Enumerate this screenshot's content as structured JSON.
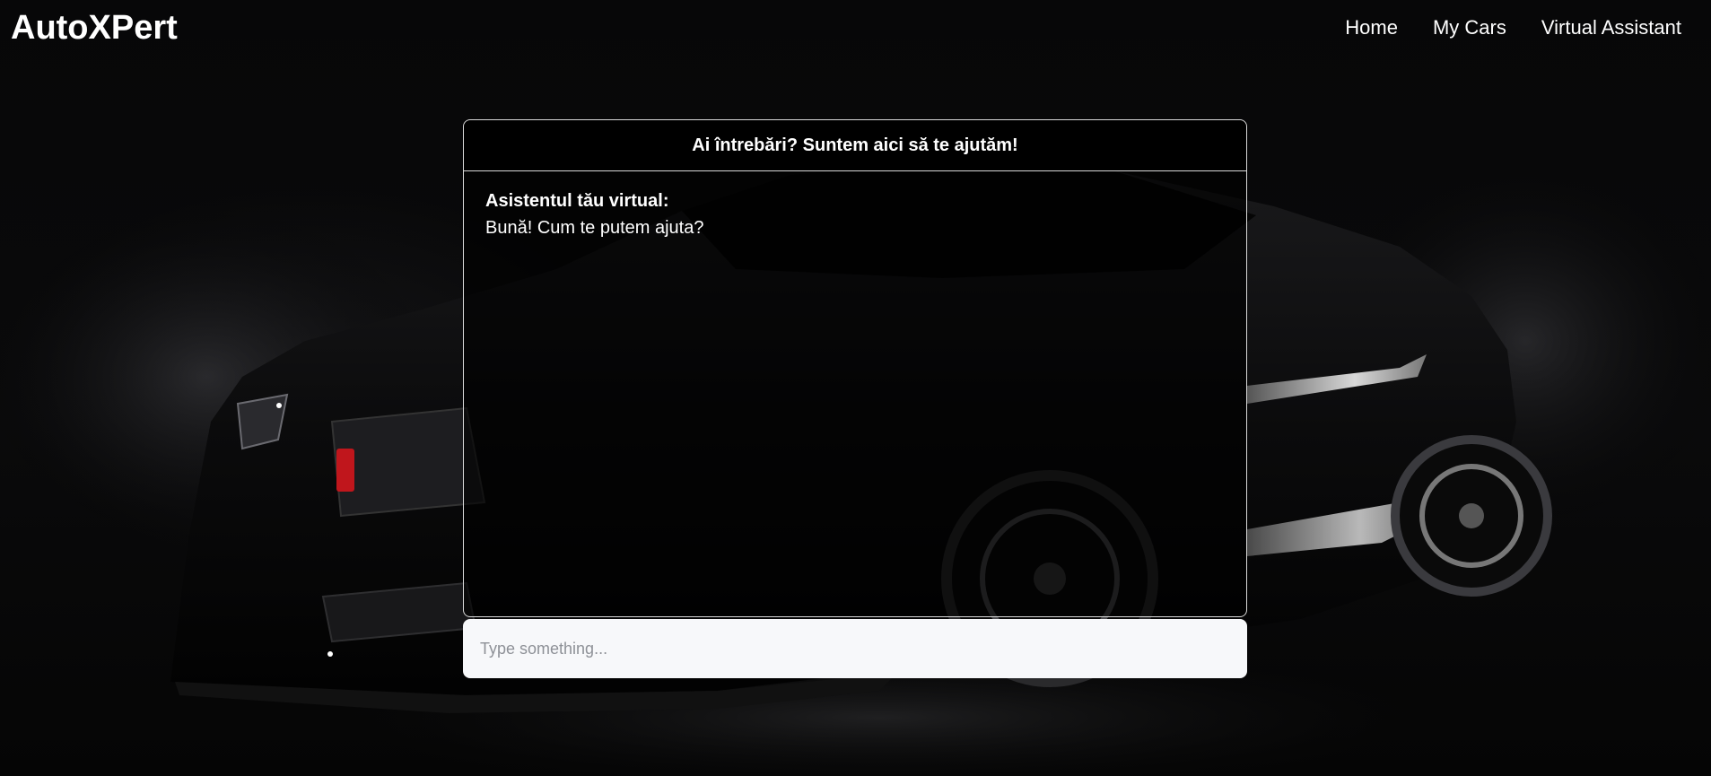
{
  "header": {
    "logo": "AutoXPert",
    "nav": [
      {
        "label": "Home"
      },
      {
        "label": "My Cars"
      },
      {
        "label": "Virtual Assistant"
      }
    ]
  },
  "hero": {
    "icon": "sports-car-image"
  },
  "chat": {
    "title": "Ai întrebări? Suntem aici să te ajutăm!",
    "messages": [
      {
        "sender": "Asistentul tău virtual:",
        "text": "Bună! Cum te putem ajuta?"
      }
    ],
    "input": {
      "placeholder": "Type something...",
      "value": ""
    }
  },
  "colors": {
    "background": "#060607",
    "text": "#ffffff",
    "panel_border": "#d9d9d9",
    "input_bg": "#f7f8fa",
    "accent_red": "#c0161c"
  }
}
